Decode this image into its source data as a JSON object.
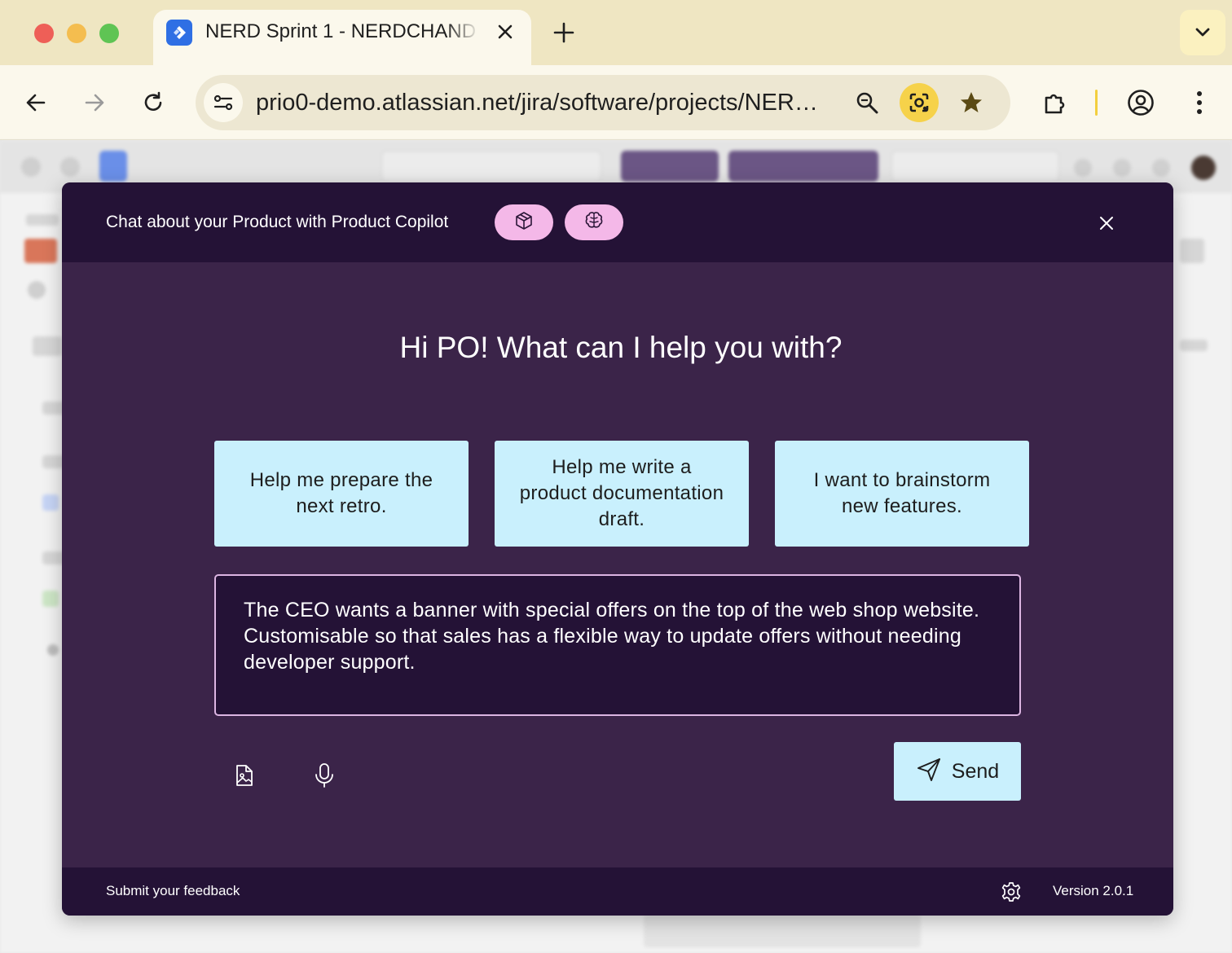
{
  "browser": {
    "tab_title": "NERD Sprint 1 - NERDCHAND",
    "url": "prio0-demo.atlassian.net/jira/software/projects/NER…"
  },
  "modal": {
    "title": "Chat about your Product with Product Copilot",
    "greeting": "Hi PO! What can I help you with?",
    "suggestions": [
      "Help me prepare the next retro.",
      "Help me write a product documentation draft.",
      "I want to brainstorm new features."
    ],
    "prompt_text": "The CEO wants a banner with special offers on the top of the web shop website. Customisable so that sales has a flexible way to update offers without needing developer support.",
    "send_label": "Send",
    "footer": {
      "feedback": "Submit your feedback",
      "version": "Version 2.0.1"
    }
  },
  "colors": {
    "modal_background": "#3b2449",
    "modal_header": "#241236",
    "suggestion_background": "#c9f0fd",
    "chip_background": "#f4b8e8",
    "browser_frame": "#efe6c2"
  },
  "icons": [
    "jira-favicon-icon",
    "close-tab-icon",
    "new-tab-icon",
    "tab-search-icon",
    "back-icon",
    "forward-icon",
    "reload-icon",
    "site-info-icon",
    "zoom-icon",
    "google-lens-icon",
    "bookmark-star-icon",
    "extensions-icon",
    "profile-icon",
    "menu-icon",
    "cube-icon",
    "brain-icon",
    "close-icon",
    "attach-image-icon",
    "microphone-icon",
    "send-icon",
    "settings-gear-icon"
  ]
}
